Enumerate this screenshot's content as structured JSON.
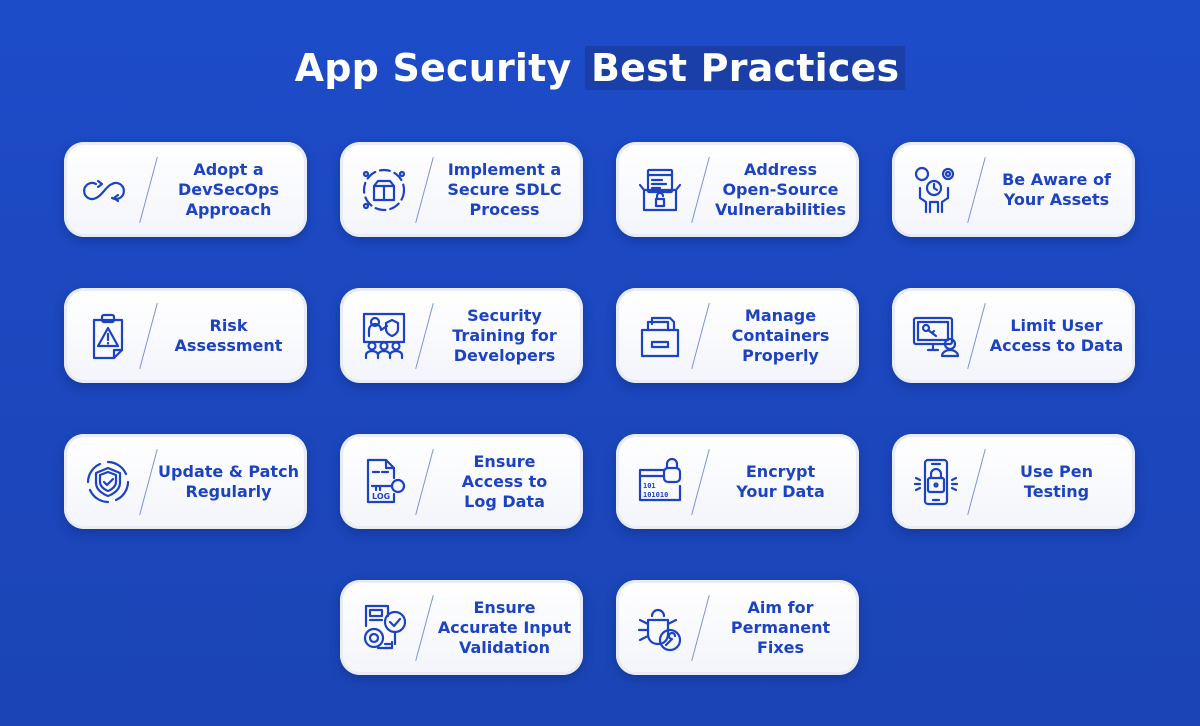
{
  "title": {
    "part1": "App Security",
    "part2": "Best Practices"
  },
  "colors": {
    "background": "#1d4cc9",
    "card": "#ffffff",
    "accent_text": "#1c43c0",
    "title_highlight": "#1a3fa8"
  },
  "practices": [
    {
      "label": "Adopt a\nDevSecOps\nApproach",
      "icon": "infinity-loop-icon"
    },
    {
      "label": "Implement a\nSecure SDLC\nProcess",
      "icon": "box-cycle-icon"
    },
    {
      "label": "Address\nOpen-Source\nVulnerabilities",
      "icon": "open-box-code-icon"
    },
    {
      "label": "Be Aware of\nYour  Assets",
      "icon": "person-assets-icon"
    },
    {
      "label": "Risk\nAssessment",
      "icon": "clipboard-warning-icon"
    },
    {
      "label": "Security\nTraining for\nDevelopers",
      "icon": "training-class-icon"
    },
    {
      "label": "Manage\nContainers\nProperly",
      "icon": "file-container-icon"
    },
    {
      "label": "Limit User\nAccess to Data",
      "icon": "monitor-key-user-icon"
    },
    {
      "label": "Update & Patch\nRegularly",
      "icon": "shield-refresh-icon"
    },
    {
      "label": "Ensure\nAccess to\nLog Data",
      "icon": "log-file-key-icon"
    },
    {
      "label": "Encrypt\nYour Data",
      "icon": "binary-lock-icon"
    },
    {
      "label": "Use Pen\nTesting",
      "icon": "phone-lock-icon"
    },
    {
      "label": "Ensure\nAccurate Input\nValidation",
      "icon": "document-gear-check-icon"
    },
    {
      "label": "Aim for\nPermanent\nFixes",
      "icon": "bug-wrench-icon"
    }
  ]
}
